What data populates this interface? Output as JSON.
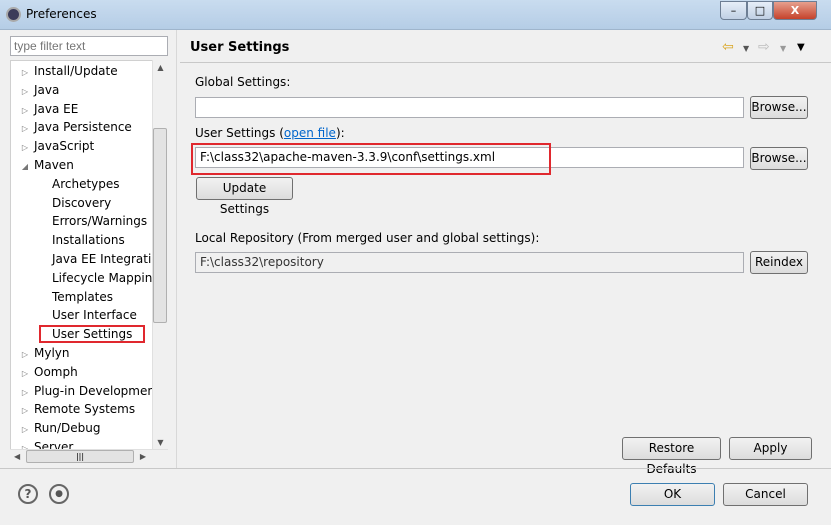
{
  "window": {
    "title": "Preferences",
    "minimize": "–",
    "maximize": "□",
    "close": "X"
  },
  "filter": {
    "placeholder": "type filter text"
  },
  "tree": {
    "items": [
      {
        "label": "Install/Update",
        "level": 0,
        "expanded": false
      },
      {
        "label": "Java",
        "level": 0,
        "expanded": false
      },
      {
        "label": "Java EE",
        "level": 0,
        "expanded": false
      },
      {
        "label": "Java Persistence",
        "level": 0,
        "expanded": false
      },
      {
        "label": "JavaScript",
        "level": 0,
        "expanded": false
      },
      {
        "label": "Maven",
        "level": 0,
        "expanded": true
      },
      {
        "label": "Archetypes",
        "level": 1
      },
      {
        "label": "Discovery",
        "level": 1
      },
      {
        "label": "Errors/Warnings",
        "level": 1
      },
      {
        "label": "Installations",
        "level": 1
      },
      {
        "label": "Java EE Integration",
        "level": 1
      },
      {
        "label": "Lifecycle Mapping",
        "level": 1
      },
      {
        "label": "Templates",
        "level": 1
      },
      {
        "label": "User Interface",
        "level": 1
      },
      {
        "label": "User Settings",
        "level": 1,
        "selected": true
      },
      {
        "label": "Mylyn",
        "level": 0,
        "expanded": false
      },
      {
        "label": "Oomph",
        "level": 0,
        "expanded": false
      },
      {
        "label": "Plug-in Development",
        "level": 0,
        "expanded": false
      },
      {
        "label": "Remote Systems",
        "level": 0,
        "expanded": false
      },
      {
        "label": "Run/Debug",
        "level": 0,
        "expanded": false
      },
      {
        "label": "Server",
        "level": 0,
        "expanded": false
      }
    ]
  },
  "page": {
    "title": "User Settings",
    "global_label": "Global Settings:",
    "global_value": "",
    "browse": "Browse...",
    "user_label_pre": "User Settings (",
    "user_link": "open file",
    "user_label_post": "):",
    "user_value": "F:\\class32\\apache-maven-3.3.9\\conf\\settings.xml",
    "update": "Update Settings",
    "local_label": "Local Repository (From merged user and global settings):",
    "local_value": "F:\\class32\\repository",
    "reindex": "Reindex",
    "restore": "Restore Defaults",
    "apply": "Apply"
  },
  "footer": {
    "ok": "OK",
    "cancel": "Cancel",
    "help": "?"
  },
  "colors": {
    "highlight": "#e0282e",
    "link": "#0066cc"
  }
}
